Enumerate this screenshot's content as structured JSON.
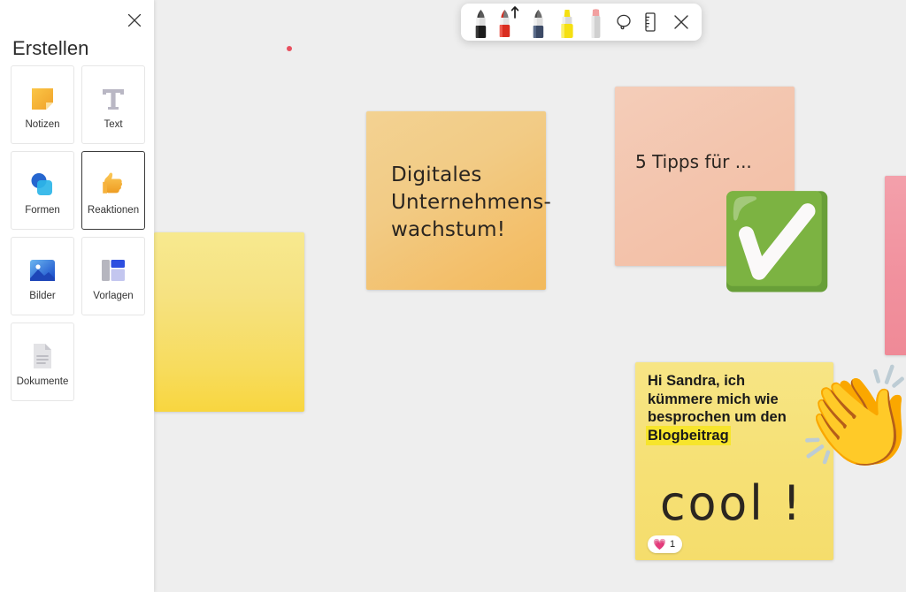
{
  "app": {
    "canvas_background": "#eeeeee"
  },
  "create_panel": {
    "title": "Erstellen",
    "close_icon": "close-icon",
    "tiles": [
      {
        "label": "Notizen",
        "icon": "sticky-note-icon",
        "selected": false
      },
      {
        "label": "Text",
        "icon": "text-t-icon",
        "selected": false
      },
      {
        "label": "Formen",
        "icon": "shapes-icon",
        "selected": false
      },
      {
        "label": "Reaktionen",
        "icon": "thumbs-up-icon",
        "selected": true
      },
      {
        "label": "Bilder",
        "icon": "image-icon",
        "selected": false
      },
      {
        "label": "Vorlagen",
        "icon": "templates-icon",
        "selected": false
      },
      {
        "label": "Dokumente",
        "icon": "document-icon",
        "selected": false
      }
    ]
  },
  "pen_toolbar": {
    "tools": [
      {
        "name": "pen-black",
        "color": "#1c1c1c",
        "selected": false
      },
      {
        "name": "pen-red-active",
        "color": "#d92d20",
        "selected": true
      },
      {
        "name": "pen-blue",
        "color": "#3c4a66",
        "selected": false
      },
      {
        "name": "highlighter-yellow",
        "color": "#f5e012",
        "selected": false
      },
      {
        "name": "eraser",
        "color": "#f2a0a0",
        "selected": false
      },
      {
        "name": "lasso-select-icon",
        "color": "#333333",
        "selected": false
      },
      {
        "name": "ruler-icon",
        "color": "#333333",
        "selected": false
      },
      {
        "name": "close-icon",
        "color": "#333333",
        "selected": false
      }
    ]
  },
  "notes": {
    "yellow_left": {
      "text": "",
      "color_top": "#f7e98f",
      "color_bottom": "#f8d63f"
    },
    "orange": {
      "text": "Digitales\nUnternehmens-\nwachstum!",
      "color_top": "#f3d292",
      "color_bottom": "#f2b95c"
    },
    "pink": {
      "text": "5 Tipps für ...",
      "color_top": "#f4cdb9",
      "color_bottom": "#f3bda3"
    },
    "pink_right": {
      "text": "",
      "color_top": "#f3a0ab",
      "color_bottom": "#ef8a97"
    },
    "yellow_right": {
      "typed_line1": "Hi Sandra, ich",
      "typed_line2": "kümmere mich wie",
      "typed_line3": "besprochen um den",
      "typed_highlight": "Blogbeitrag",
      "handwriting": "cool !",
      "reaction_emoji": "💗",
      "reaction_count": "1",
      "color_top": "#f7e585",
      "color_bottom": "#f5dd6c"
    }
  },
  "stickers": {
    "check": "✅",
    "clap": "👏",
    "red_dot_color": "#e8505f"
  }
}
